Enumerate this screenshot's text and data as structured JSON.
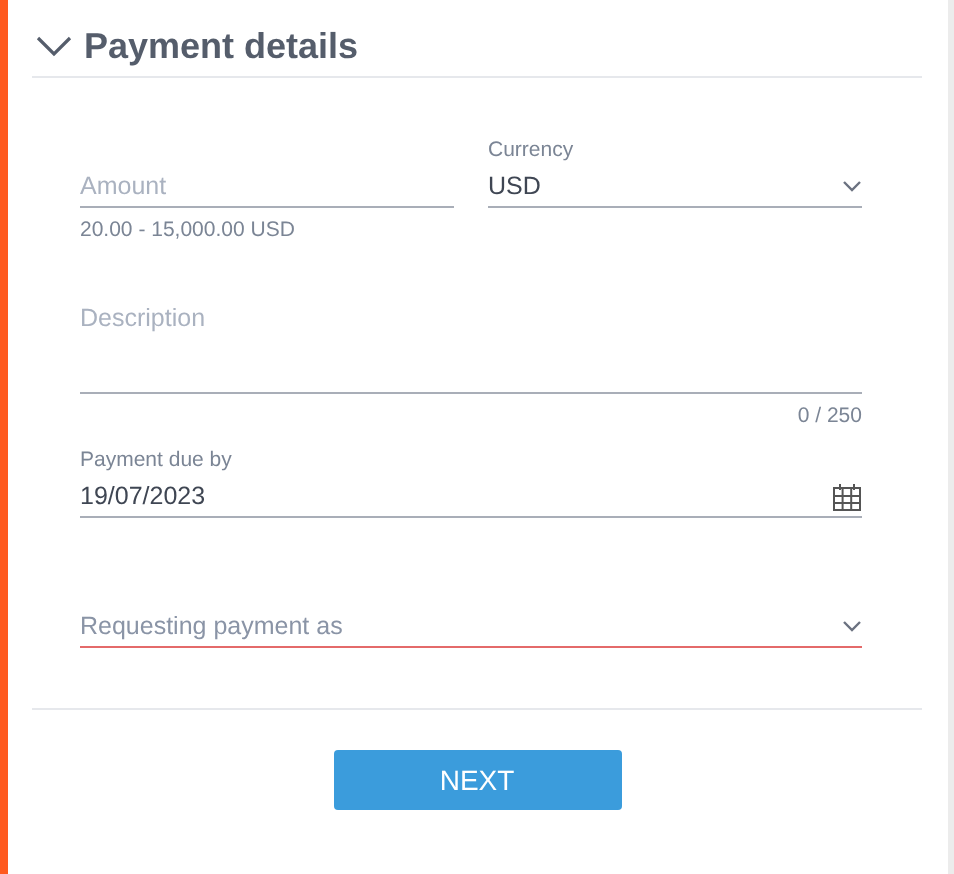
{
  "section": {
    "title": "Payment details",
    "expanded": true
  },
  "amount": {
    "placeholder": "Amount",
    "hint": "20.00 - 15,000.00 USD"
  },
  "currency": {
    "label": "Currency",
    "value": "USD"
  },
  "description": {
    "placeholder": "Description",
    "counter": "0 / 250"
  },
  "due_date": {
    "label": "Payment due by",
    "value": "19/07/2023"
  },
  "requesting_as": {
    "placeholder": "Requesting payment as",
    "invalid": true
  },
  "buttons": [
    "NEXT"
  ]
}
